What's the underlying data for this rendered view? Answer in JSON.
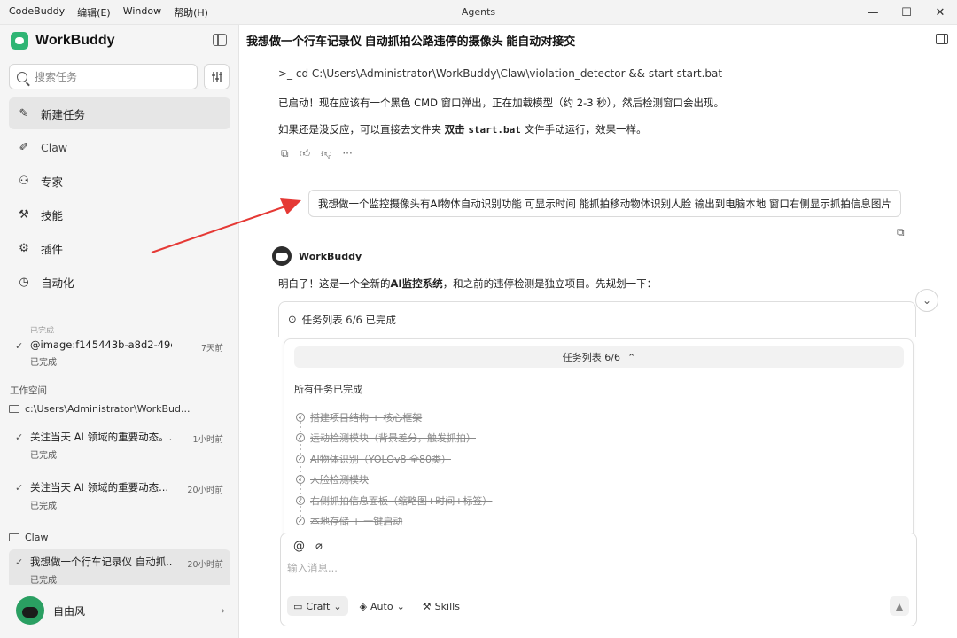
{
  "menubar": {
    "app": "CodeBuddy",
    "edit": "编辑(E)",
    "window": "Window",
    "help": "帮助(H)"
  },
  "window_title": "Agents",
  "window_controls": {
    "minimize": "—",
    "maximize": "☐",
    "close": "✕"
  },
  "sidebar": {
    "brand": "WorkBuddy",
    "search_placeholder": "搜索任务",
    "nav": [
      {
        "label": "新建任务",
        "icon": "✎"
      },
      {
        "label": "Claw",
        "icon": "✐"
      },
      {
        "label": "专家",
        "icon": "⚇"
      },
      {
        "label": "技能",
        "icon": "⚒"
      },
      {
        "label": "插件",
        "icon": "⚙"
      },
      {
        "label": "自动化",
        "icon": "◷"
      }
    ],
    "faded_status": "已完成",
    "tasks_top": [
      {
        "title": "@image:f145443b-a8d2-49e7-a...",
        "time": "7天前",
        "status": "已完成"
      }
    ],
    "workspace_label": "工作空间",
    "workspace_folder": "c:\\Users\\Administrator\\WorkBud...",
    "workspace_tasks": [
      {
        "title": "关注当天 AI 领域的重要动态。...",
        "time": "1小时前",
        "status": "已完成"
      },
      {
        "title": "关注当天 AI 领域的重要动态...",
        "time": "20小时前",
        "status": "已完成"
      }
    ],
    "claw_folder": "Claw",
    "claw_tasks": [
      {
        "title": "我想做一个行车记录仪 自动抓...",
        "time": "20小时前",
        "status": "已完成"
      }
    ],
    "user_name": "自由风"
  },
  "main": {
    "title": "我想做一个行车记录仪 自动抓拍公路违停的摄像头 能自动对接交",
    "command": "cd C:\\Users\\Administrator\\WorkBuddy\\Claw\\violation_detector && start start.bat",
    "msg1": "已启动！现在应该有一个黑色 CMD 窗口弹出，正在加载模型（约 2-3 秒），然后检测窗口会出现。",
    "msg2_a": "如果还是没反应，可以直接去文件夹 ",
    "msg2_b": "双击",
    "msg2_c": "start.bat",
    "msg2_d": " 文件手动运行，效果一样。",
    "user_message": "我想做一个监控摄像头有AI物体自动识别功能 可显示时间 能抓拍移动物体识别人脸 输出到电脑本地 窗口右侧显示抓拍信息图片",
    "bot_name": "WorkBuddy",
    "bot_reply_a": "明白了！这是一个全新的",
    "bot_reply_b": "AI监控系统",
    "bot_reply_c": "，和之前的违停检测是独立项目。先规划一下：",
    "tasklist_summary": "任务列表 6/6 已完成"
  },
  "task_panel": {
    "header": "任务列表 6/6",
    "all_done": "所有任务已完成",
    "items": [
      "搭建项目结构 + 核心框架",
      "运动检测模块（背景差分，触发抓拍）",
      "AI物体识别（YOLOv8 全80类）",
      "人脸检测模块",
      "右侧抓拍信息面板（缩略图+时间+标签）",
      "本地存储 + 一键启动"
    ]
  },
  "composer": {
    "placeholder": "输入消息...",
    "chips": [
      "Craft",
      "Auto",
      "Skills"
    ]
  },
  "colors": {
    "accent": "#2fb574",
    "arrow": "#e53935"
  }
}
